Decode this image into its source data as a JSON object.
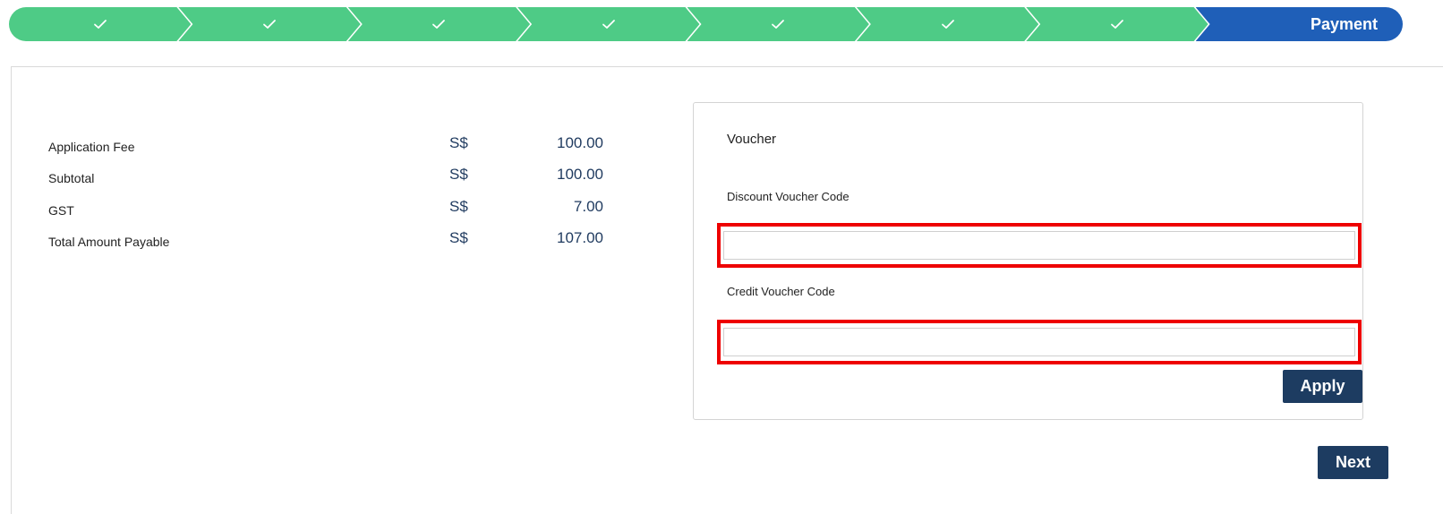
{
  "stepper": {
    "steps": [
      {
        "label": "",
        "state": "done",
        "icon": "check-icon"
      },
      {
        "label": "",
        "state": "done",
        "icon": "check-icon"
      },
      {
        "label": "",
        "state": "done",
        "icon": "check-icon"
      },
      {
        "label": "",
        "state": "done",
        "icon": "check-icon"
      },
      {
        "label": "",
        "state": "done",
        "icon": "check-icon"
      },
      {
        "label": "",
        "state": "done",
        "icon": "check-icon"
      },
      {
        "label": "",
        "state": "done",
        "icon": "check-icon"
      },
      {
        "label": "Payment",
        "state": "active"
      }
    ],
    "colors": {
      "done": "#4ecb86",
      "active": "#1f5fb8"
    }
  },
  "fees": {
    "rows": [
      {
        "label": "Application Fee",
        "currency": "S$",
        "amount": "100.00"
      },
      {
        "label": "Subtotal",
        "currency": "S$",
        "amount": "100.00"
      },
      {
        "label": "GST",
        "currency": "S$",
        "amount": "7.00"
      },
      {
        "label": "Total Amount Payable",
        "currency": "S$",
        "amount": "107.00"
      }
    ]
  },
  "voucher": {
    "title": "Voucher",
    "discount_label": "Discount Voucher Code",
    "discount_value": "",
    "credit_label": "Credit Voucher Code",
    "credit_value": "",
    "apply_label": "Apply",
    "highlight_color": "#ee0000"
  },
  "actions": {
    "next_label": "Next",
    "button_color": "#1d3c61"
  }
}
